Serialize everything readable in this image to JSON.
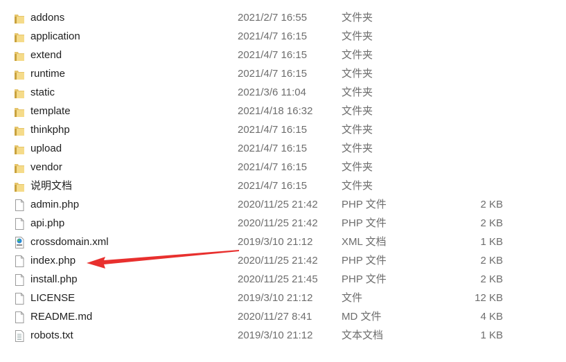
{
  "files": [
    {
      "name": "addons",
      "date": "2021/2/7 16:55",
      "type": "文件夹",
      "size": "",
      "icon": "folder"
    },
    {
      "name": "application",
      "date": "2021/4/7 16:15",
      "type": "文件夹",
      "size": "",
      "icon": "folder"
    },
    {
      "name": "extend",
      "date": "2021/4/7 16:15",
      "type": "文件夹",
      "size": "",
      "icon": "folder"
    },
    {
      "name": "runtime",
      "date": "2021/4/7 16:15",
      "type": "文件夹",
      "size": "",
      "icon": "folder"
    },
    {
      "name": "static",
      "date": "2021/3/6 11:04",
      "type": "文件夹",
      "size": "",
      "icon": "folder"
    },
    {
      "name": "template",
      "date": "2021/4/18 16:32",
      "type": "文件夹",
      "size": "",
      "icon": "folder"
    },
    {
      "name": "thinkphp",
      "date": "2021/4/7 16:15",
      "type": "文件夹",
      "size": "",
      "icon": "folder"
    },
    {
      "name": "upload",
      "date": "2021/4/7 16:15",
      "type": "文件夹",
      "size": "",
      "icon": "folder"
    },
    {
      "name": "vendor",
      "date": "2021/4/7 16:15",
      "type": "文件夹",
      "size": "",
      "icon": "folder"
    },
    {
      "name": "说明文档",
      "date": "2021/4/7 16:15",
      "type": "文件夹",
      "size": "",
      "icon": "folder"
    },
    {
      "name": "admin.php",
      "date": "2020/11/25 21:42",
      "type": "PHP 文件",
      "size": "2 KB",
      "icon": "file"
    },
    {
      "name": "api.php",
      "date": "2020/11/25 21:42",
      "type": "PHP 文件",
      "size": "2 KB",
      "icon": "file"
    },
    {
      "name": "crossdomain.xml",
      "date": "2019/3/10 21:12",
      "type": "XML 文档",
      "size": "1 KB",
      "icon": "xml"
    },
    {
      "name": "index.php",
      "date": "2020/11/25 21:42",
      "type": "PHP 文件",
      "size": "2 KB",
      "icon": "file"
    },
    {
      "name": "install.php",
      "date": "2020/11/25 21:45",
      "type": "PHP 文件",
      "size": "2 KB",
      "icon": "file"
    },
    {
      "name": "LICENSE",
      "date": "2019/3/10 21:12",
      "type": "文件",
      "size": "12 KB",
      "icon": "file"
    },
    {
      "name": "README.md",
      "date": "2020/11/27 8:41",
      "type": "MD 文件",
      "size": "4 KB",
      "icon": "file"
    },
    {
      "name": "robots.txt",
      "date": "2019/3/10 21:12",
      "type": "文本文档",
      "size": "1 KB",
      "icon": "text"
    }
  ],
  "annotation": {
    "arrow_color": "#e8302e",
    "points_to": "index.php"
  }
}
